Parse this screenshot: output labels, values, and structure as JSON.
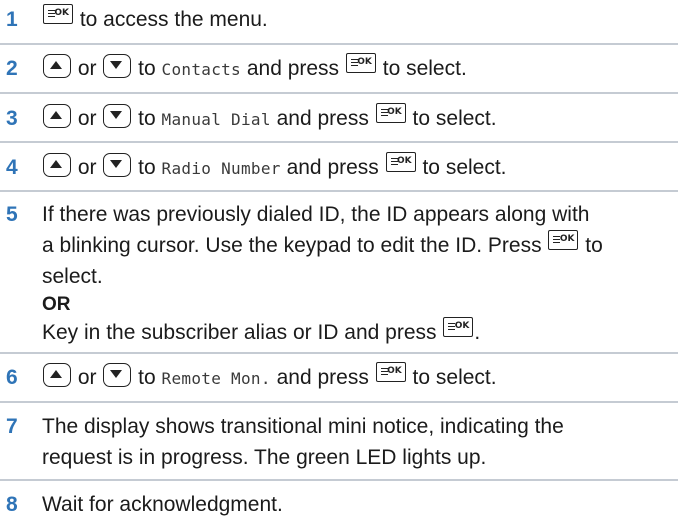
{
  "steps": [
    {
      "number": "1",
      "text_after_key": " to access the menu."
    },
    {
      "number": "2",
      "or": " or ",
      "to": " to ",
      "target": "Contacts",
      "press": " and press ",
      "end": " to select."
    },
    {
      "number": "3",
      "or": " or ",
      "to": " to ",
      "target": "Manual Dial",
      "press": " and press ",
      "end": " to select."
    },
    {
      "number": "4",
      "or": " or ",
      "to": " to ",
      "target": "Radio Number",
      "press": " and press ",
      "end": " to select."
    },
    {
      "number": "5",
      "line1": "If there was previously dialed ID, the ID appears along with",
      "line2": "a blinking cursor. Use the keypad to edit the ID. Press ",
      "line2_end": " to",
      "line3": "select.",
      "or_label": "OR",
      "line5": "Key in the subscriber alias or ID and press ",
      "line5_end": "."
    },
    {
      "number": "6",
      "or": " or ",
      "to": " to ",
      "target": "Remote Mon.",
      "press": " and press ",
      "end": " to select."
    },
    {
      "number": "7",
      "line1": "The display shows transitional mini notice, indicating the",
      "line2": "request is in progress. The green LED lights up."
    },
    {
      "number": "8",
      "text": "Wait for acknowledgment."
    }
  ],
  "icons": {
    "ok_key_label": "OK",
    "menu_ok_key": "menu-ok-key-icon",
    "up_key": "up-arrow-key-icon",
    "down_key": "down-arrow-key-icon"
  },
  "colors": {
    "step_number": "#2f74b7",
    "divider": "#c5cbd3"
  }
}
